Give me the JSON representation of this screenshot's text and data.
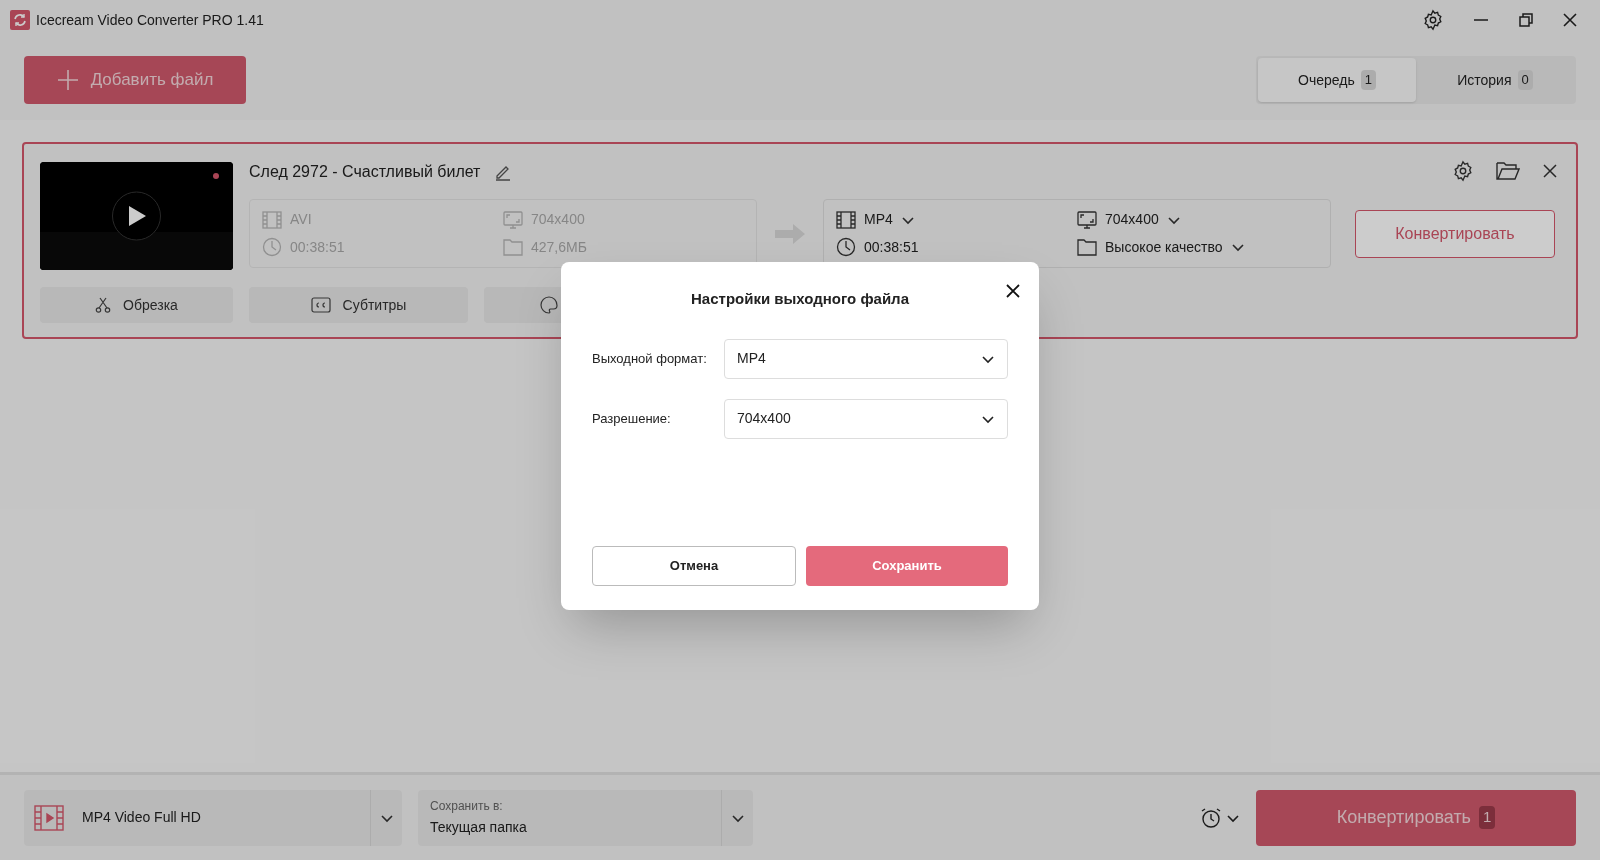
{
  "window": {
    "title": "Icecream Video Converter PRO 1.41"
  },
  "toolbar": {
    "add_button": "Добавить файл",
    "tabs": [
      {
        "label": "Очередь",
        "count": "1",
        "selected": true
      },
      {
        "label": "История",
        "count": "0",
        "selected": false
      }
    ]
  },
  "file_card": {
    "title": "След 2972 - Счастливый билет",
    "source": {
      "format": "AVI",
      "duration": "00:38:51",
      "resolution": "704x400",
      "size": "427,6МБ"
    },
    "output": {
      "format": "MP4",
      "duration": "00:38:51",
      "resolution": "704x400",
      "quality": "Высокое качество"
    },
    "convert_button": "Конвертировать",
    "tools": [
      {
        "kind": "trim",
        "label": "Обрезка"
      },
      {
        "kind": "subtitles",
        "label": "Субтитры"
      },
      {
        "kind": "effects"
      }
    ]
  },
  "dialog": {
    "title": "Настройки выходного файла",
    "fields": [
      {
        "label": "Выходной формат:",
        "value": "MP4"
      },
      {
        "label": "Разрешение:",
        "value": "704x400"
      }
    ],
    "cancel": "Отмена",
    "save": "Сохранить"
  },
  "bottom_bar": {
    "preset": "MP4 Video Full HD",
    "save_to_label": "Сохранить в:",
    "save_to_value": "Текущая папка",
    "convert_button": "Конвертировать",
    "convert_count": "1"
  }
}
